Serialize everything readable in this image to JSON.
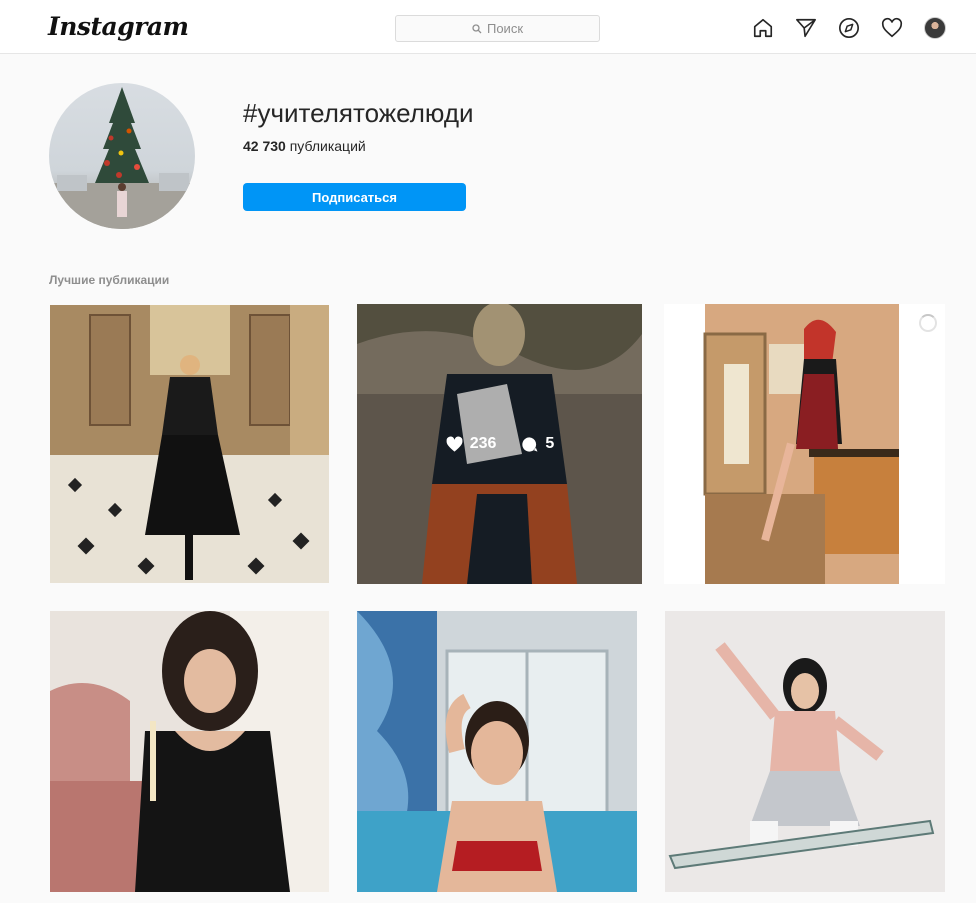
{
  "header": {
    "logo": "Instagram",
    "search_placeholder": "Поиск",
    "nav_icons": [
      "home-icon",
      "direct-icon",
      "explore-icon",
      "activity-icon",
      "profile-avatar"
    ]
  },
  "hashtag": {
    "title": "#учителятожелюди",
    "posts_count": "42 730",
    "posts_label": "публикаций",
    "follow_label": "Подписаться"
  },
  "section": {
    "top_posts_label": "Лучшие публикации"
  },
  "posts": [
    {
      "likes": "",
      "comments": ""
    },
    {
      "likes": "236",
      "comments": "5"
    },
    {
      "likes": "",
      "comments": ""
    },
    {
      "likes": "",
      "comments": ""
    },
    {
      "likes": "",
      "comments": ""
    },
    {
      "likes": "",
      "comments": ""
    }
  ],
  "colors": {
    "accent": "#0095f6",
    "muted": "#8e8e8e",
    "border": "#dbdbdb"
  }
}
